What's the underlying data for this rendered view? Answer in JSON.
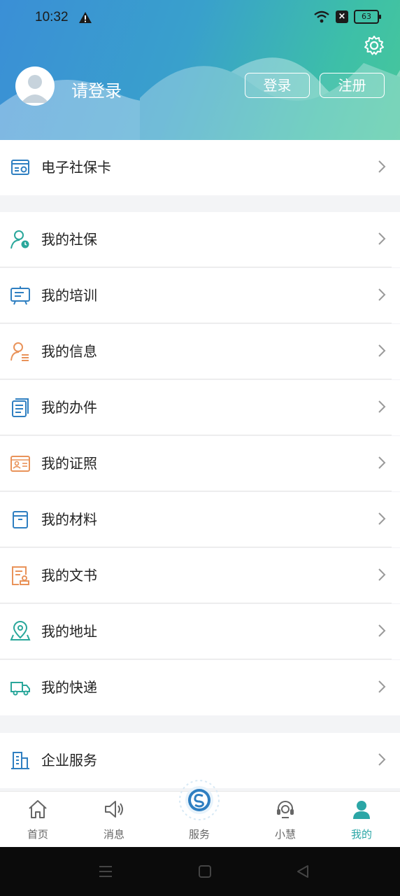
{
  "status_bar": {
    "time": "10:32",
    "battery": "63"
  },
  "header": {
    "login_prompt": "请登录",
    "login_button": "登录",
    "register_button": "注册"
  },
  "menu": {
    "social_card": "电子社保卡",
    "items": [
      "我的社保",
      "我的培训",
      "我的信息",
      "我的办件",
      "我的证照",
      "我的材料",
      "我的文书",
      "我的地址",
      "我的快递"
    ],
    "enterprise": "企业服务"
  },
  "tabs": [
    "首页",
    "消息",
    "服务",
    "小慧",
    "我的"
  ],
  "colors": {
    "accent": "#2ba6a6",
    "icon_blue": "#2f7fc1",
    "icon_orange": "#e9935a",
    "icon_teal": "#2aa79b"
  }
}
